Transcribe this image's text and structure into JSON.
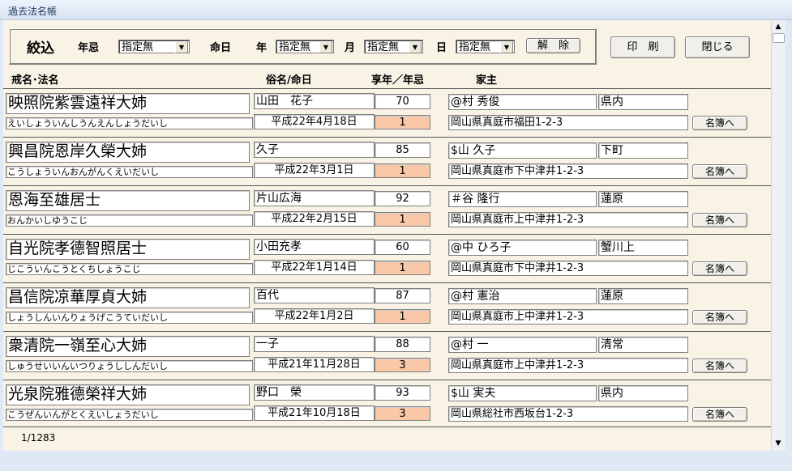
{
  "window": {
    "title": "過去法名帳"
  },
  "filter": {
    "label": "絞込",
    "nenki_label": "年忌",
    "nenki_value": "指定無",
    "meinichi_label": "命日",
    "year_label": "年",
    "year_value": "指定無",
    "month_label": "月",
    "month_value": "指定無",
    "day_label": "日",
    "day_value": "指定無",
    "clear_button": "解　除"
  },
  "toolbar": {
    "print_button": "印　刷",
    "close_button": "閉じる"
  },
  "columns": {
    "kaimyo": "戒名･法名",
    "zokumyo": "俗名/命日",
    "age": "享年／年忌",
    "koshu": "家主"
  },
  "records": [
    {
      "kaimyo": "映照院紫雲遠祥大姉",
      "yomi": "えいしょういんしうんえんしょうだいし",
      "zokumyo": "山田　花子",
      "date": "平成22年4月18日",
      "age": "70",
      "nenki": "1",
      "koshu": "@村 秀俊",
      "area": "県内",
      "address": "岡山県真庭市福田1-2-3",
      "button": "名簿へ"
    },
    {
      "kaimyo": "興昌院恩岸久榮大姉",
      "yomi": "こうしょういんおんがんくえいだいし",
      "zokumyo": "久子",
      "date": "平成22年3月1日",
      "age": "85",
      "nenki": "1",
      "koshu": "$山 久子",
      "area": "下町",
      "address": "岡山県真庭市下中津井1-2-3",
      "button": "名簿へ"
    },
    {
      "kaimyo": "恩海至雄居士",
      "yomi": "おんかいしゆうこじ",
      "zokumyo": "片山広海",
      "date": "平成22年2月15日",
      "age": "92",
      "nenki": "1",
      "koshu": "＃谷 隆行",
      "area": "蓮原",
      "address": "岡山県真庭市上中津井1-2-3",
      "button": "名簿へ"
    },
    {
      "kaimyo": "自光院孝德智照居士",
      "yomi": "じこういんこうとくちしょうこじ",
      "zokumyo": "小田充孝",
      "date": "平成22年1月14日",
      "age": "60",
      "nenki": "1",
      "koshu": "@中 ひろ子",
      "area": "蟹川上",
      "address": "岡山県真庭市下中津井1-2-3",
      "button": "名簿へ"
    },
    {
      "kaimyo": "昌信院凉華厚貞大姉",
      "yomi": "しょうしんいんりょうげこうていだいし",
      "zokumyo": "百代",
      "date": "平成22年1月2日",
      "age": "87",
      "nenki": "1",
      "koshu": "@村 憲治",
      "area": "蓮原",
      "address": "岡山県真庭市上中津井1-2-3",
      "button": "名簿へ"
    },
    {
      "kaimyo": "衆清院一嶺至心大姉",
      "yomi": "しゅうせいいんいつりょうししんだいし",
      "zokumyo": "一子",
      "date": "平成21年11月28日",
      "age": "88",
      "nenki": "3",
      "koshu": "@村 一",
      "area": "清常",
      "address": "岡山県真庭市上中津井1-2-3",
      "button": "名簿へ"
    },
    {
      "kaimyo": "光泉院雅德榮祥大姉",
      "yomi": "こうぜんいんがとくえいしょうだいし",
      "zokumyo": "野口　榮",
      "date": "平成21年10月18日",
      "age": "93",
      "nenki": "3",
      "koshu": "$山 実夫",
      "area": "県内",
      "address": "岡山県総社市西坂台1-2-3",
      "button": "名簿へ"
    }
  ],
  "status": {
    "record_counter": "1/1283"
  }
}
